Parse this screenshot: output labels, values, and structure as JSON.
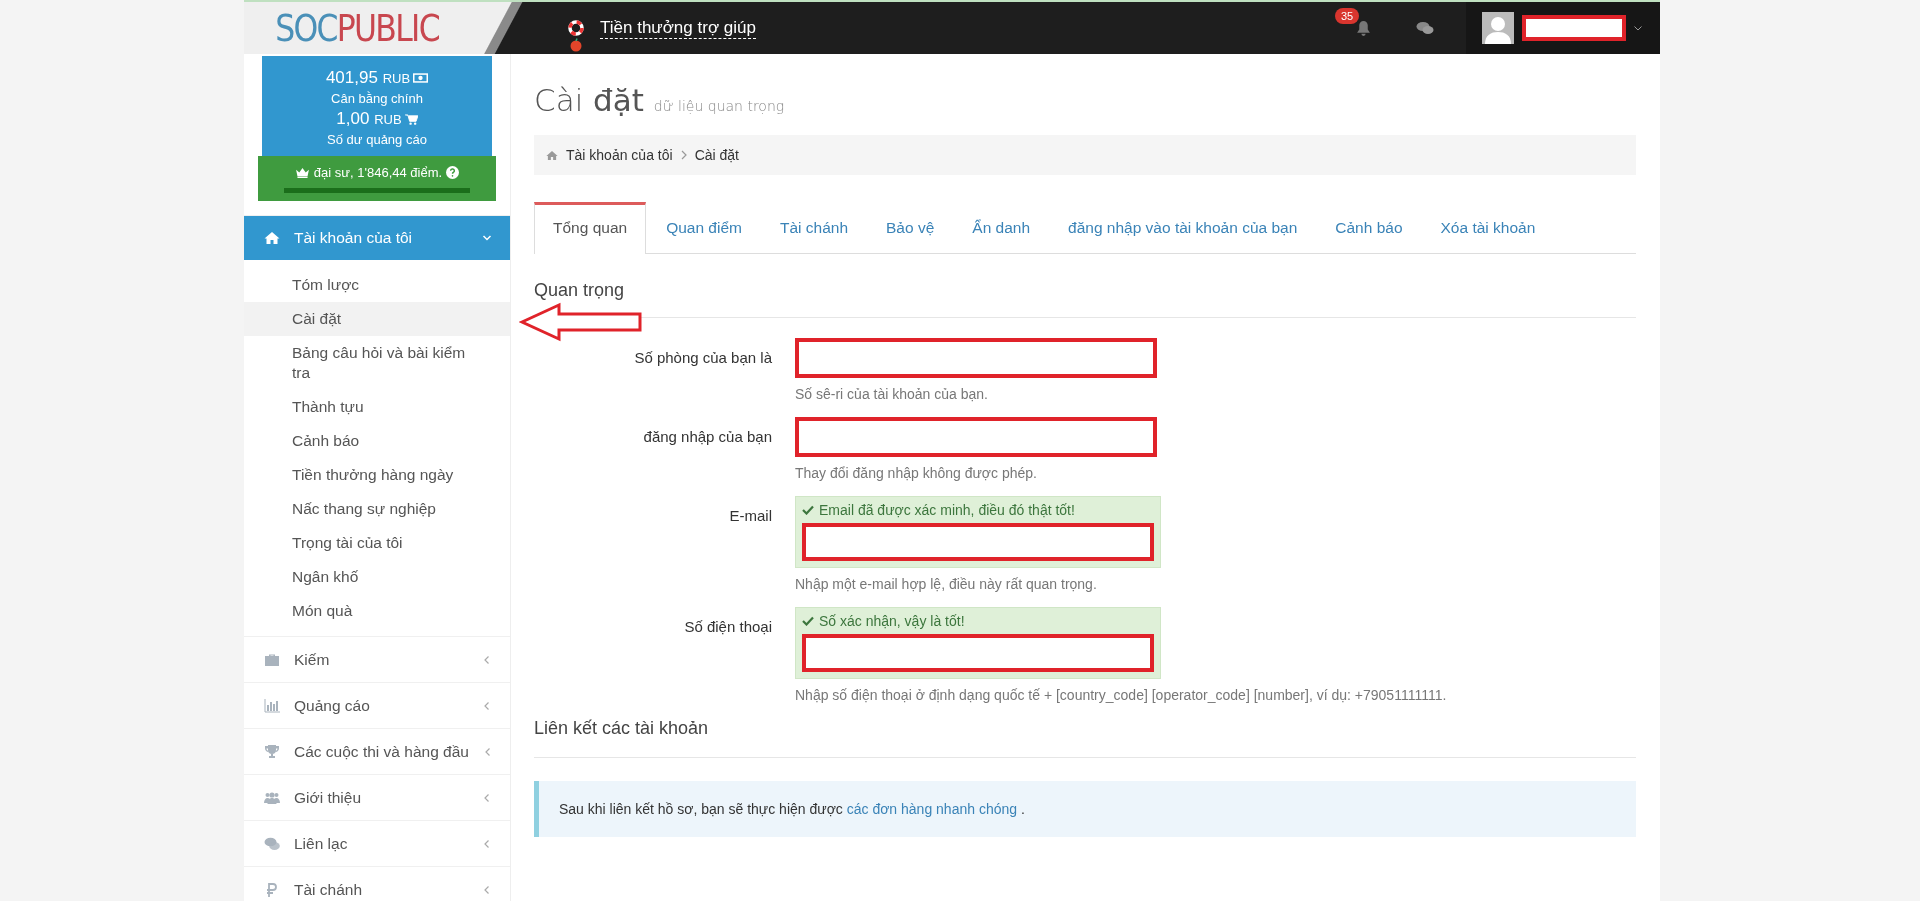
{
  "header": {
    "logo_left": "SOC",
    "logo_right": "PUBLIC",
    "help_link": "Tiền thưởng trợ giúp",
    "notification_count": "35",
    "user_redacted": true
  },
  "balance": {
    "main_amount": "401,95",
    "main_currency": "RUB",
    "main_label": "Cân bằng chính",
    "ad_amount": "1,00",
    "ad_currency": "RUB",
    "ad_label": "Số dư quảng cáo",
    "rank": "đại sư, 1'846,44 điểm."
  },
  "sidebar": {
    "items": [
      {
        "label": "Tài khoản của tôi",
        "kind": "home",
        "expanded": true,
        "children": [
          {
            "label": "Tóm lược",
            "selected": false
          },
          {
            "label": "Cài đặt",
            "selected": true
          },
          {
            "label": "Bảng câu hỏi và bài kiểm tra",
            "selected": false
          },
          {
            "label": "Thành tựu",
            "selected": false
          },
          {
            "label": "Cảnh báo",
            "selected": false
          },
          {
            "label": "Tiền thưởng hàng ngày",
            "selected": false
          },
          {
            "label": "Nấc thang sự nghiệp",
            "selected": false
          },
          {
            "label": "Trọng tài của tôi",
            "selected": false
          },
          {
            "label": "Ngân khố",
            "selected": false
          },
          {
            "label": "Món quà",
            "selected": false
          }
        ]
      },
      {
        "label": "Kiếm",
        "kind": "briefcase",
        "expanded": false
      },
      {
        "label": "Quảng cáo",
        "kind": "chart",
        "expanded": false
      },
      {
        "label": "Các cuộc thi và hàng đầu",
        "kind": "trophy",
        "expanded": false
      },
      {
        "label": "Giới thiệu",
        "kind": "users",
        "expanded": false
      },
      {
        "label": "Liên lạc",
        "kind": "chat",
        "expanded": false
      },
      {
        "label": "Tài chánh",
        "kind": "ruble",
        "expanded": false
      }
    ]
  },
  "page": {
    "title": "Cài **đặt**",
    "subtitle": "dữ liệu quan trọng",
    "breadcrumb": [
      "Tài khoản của tôi",
      "Cài đặt"
    ]
  },
  "tabs": [
    {
      "label": "Tổng quan",
      "selected": true
    },
    {
      "label": "Quan điểm",
      "selected": false
    },
    {
      "label": "Tài chánh",
      "selected": false
    },
    {
      "label": "Bảo vệ",
      "selected": false
    },
    {
      "label": "Ẩn danh",
      "selected": false
    },
    {
      "label": "đăng nhập vào tài khoản của bạn",
      "selected": false
    },
    {
      "label": "Cảnh báo",
      "selected": false
    },
    {
      "label": "Xóa tài khoản",
      "selected": false
    }
  ],
  "important": {
    "heading": "Quan trọng",
    "fields": [
      {
        "label": "Số phòng của bạn là",
        "hint": "Số sê-ri của tài khoản của bạn.",
        "redacted": true
      },
      {
        "label": "đăng nhập của bạn",
        "hint": "Thay đổi đăng nhập không được phép.",
        "redacted": true
      },
      {
        "label": "E-mail",
        "verified_message": "Email đã được xác minh, điều đó thật tốt!",
        "hint": "Nhập một e-mail hợp lệ, điều này rất quan trọng.",
        "redacted": true
      },
      {
        "label": "Số điện thoại",
        "verified_message": "Số xác nhận, vậy là tốt!",
        "hint": "Nhập số điện thoại ở định dạng quốc tế + [country_code] [operator_code] [number], ví dụ: +79051111111.",
        "redacted": true
      }
    ]
  },
  "linked": {
    "heading": "Liên kết các tài khoản",
    "info_text": "Sau khi liên kết hồ sơ, bạn sẽ thực hiện được",
    "info_link": "các đơn hàng nhanh chóng",
    "info_end": "."
  }
}
